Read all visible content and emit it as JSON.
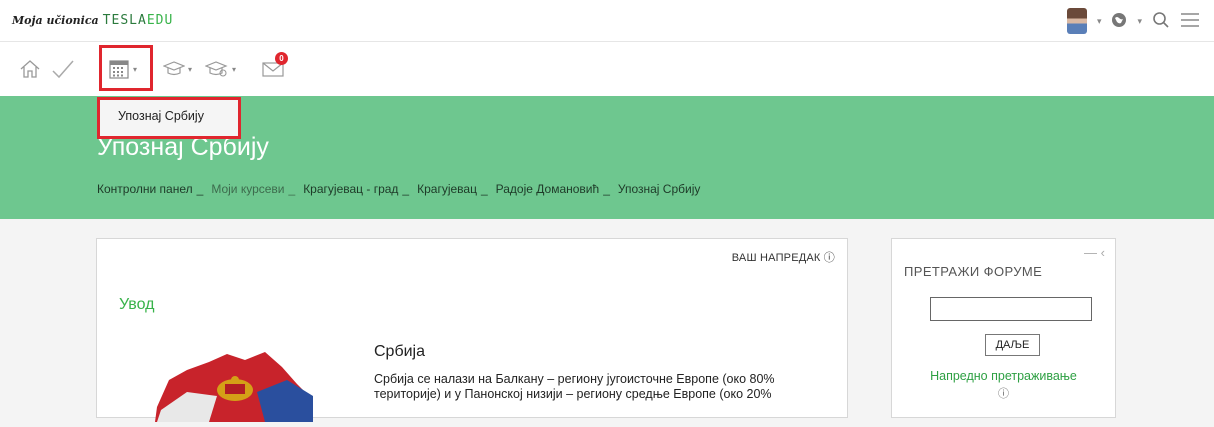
{
  "brand": {
    "script": "Moja učionica",
    "tesla": "TESLA",
    "edu": "EDU"
  },
  "topbar": {
    "avatar_caret": "▾",
    "globe_caret": "▾"
  },
  "dropdown": {
    "item": "Упознај Србију"
  },
  "hero": {
    "title": "Упознај Србију",
    "breadcrumbs": [
      "Контролни панел",
      "Моји курсеви",
      "Крагујевац - град",
      "Крагујевац",
      "Радоје Домановић",
      "Упознај Србију"
    ],
    "separator": "_"
  },
  "content": {
    "progress_label": "ВАШ НАПРЕДАК ⓘ",
    "section_title": "Увод",
    "topic_title": "Србија",
    "topic_text": "Србија се налази на Балкану – региону југоисточне Европе (око 80% територије) и у Панонској низији – региону средње Европе (око 20%"
  },
  "forum": {
    "controls": "— ‹",
    "title": "ПРЕТРАЖИ ФОРУМЕ",
    "input_value": "",
    "button": "ДАЉЕ",
    "advanced_link": "Напредно претраживање",
    "help": "ⓘ"
  },
  "mail": {
    "badge": "0"
  },
  "colors": {
    "accent_green": "#6ec78f",
    "highlight_red": "#e0262e",
    "link_green": "#38b34a"
  }
}
